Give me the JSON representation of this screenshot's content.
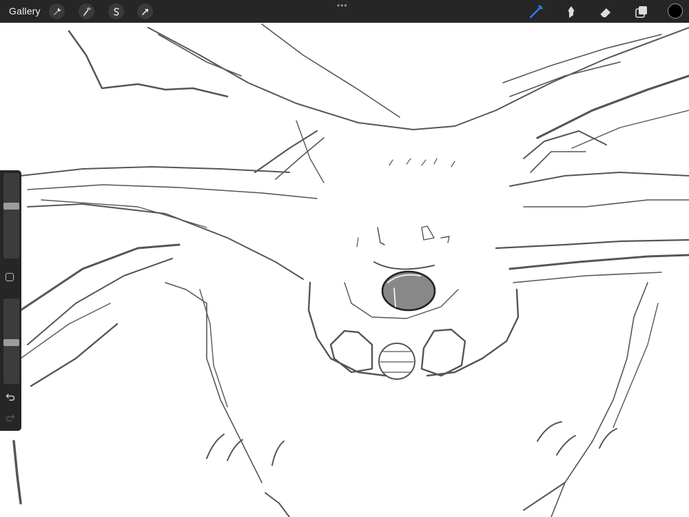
{
  "app": {
    "gallery_label": "Gallery",
    "more_menu": "•••"
  },
  "toolbar_left": [
    {
      "name": "actions",
      "icon": "wrench-icon"
    },
    {
      "name": "adjustments",
      "icon": "magic-wand-icon"
    },
    {
      "name": "selection",
      "icon": "selection-s-icon"
    },
    {
      "name": "transform",
      "icon": "arrow-cursor-icon"
    }
  ],
  "toolbar_right": [
    {
      "name": "brush",
      "icon": "brush-icon",
      "active": true
    },
    {
      "name": "smudge",
      "icon": "smudge-icon",
      "active": false
    },
    {
      "name": "eraser",
      "icon": "eraser-icon",
      "active": false
    },
    {
      "name": "layers",
      "icon": "layers-icon",
      "active": false
    }
  ],
  "colors": {
    "toolbar_bg": "#262626",
    "active_tool": "#2e7cf6",
    "current_color": "#000000",
    "stroke_color": "#5a5a5a"
  },
  "sidebar": {
    "brush_size_level": 0.62,
    "brush_opacity_level": 0.48,
    "modify_button_icon": "square-icon",
    "undo_icon": "undo-icon",
    "redo_icon": "redo-icon",
    "redo_enabled": false
  }
}
